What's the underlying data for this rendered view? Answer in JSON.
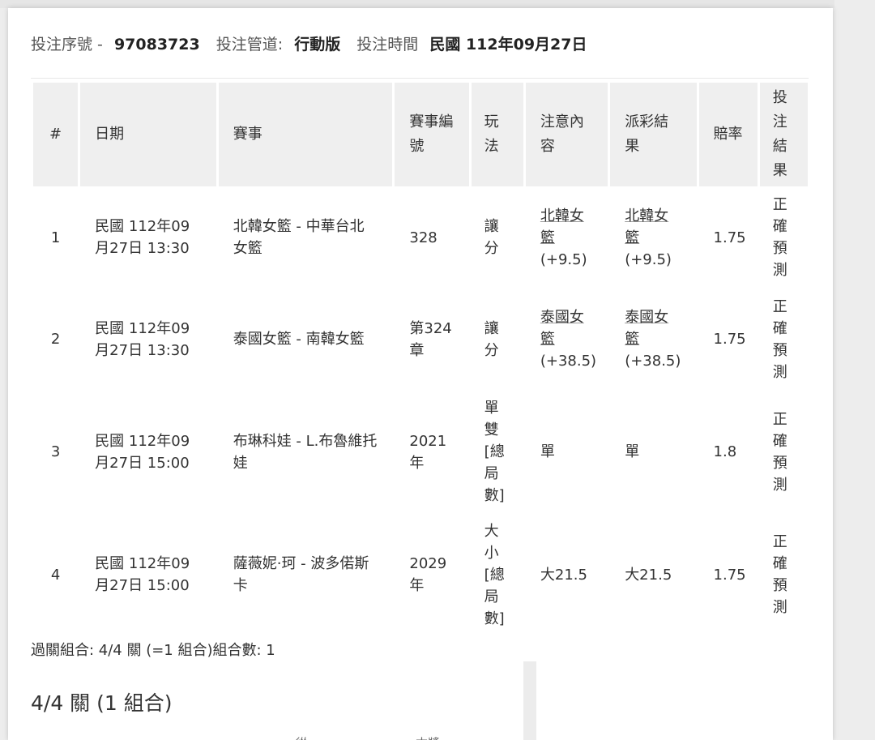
{
  "header": {
    "serial_label": "投注序號 -",
    "serial_value": "97083723",
    "channel_label": "投注管道:",
    "channel_value": "行動版",
    "time_label": "投注時間",
    "time_value": "民國 112年09月27日"
  },
  "table": {
    "headers": {
      "idx": "#",
      "date": "日期",
      "match": "賽事",
      "match_no": "賽事編號",
      "play": "玩法",
      "pick": "注意內容",
      "payout_result": "派彩結果",
      "odds": "賠率",
      "bet_result": "投注結果"
    },
    "rows": [
      {
        "idx": "1",
        "date": "民國 112年09月27日 13:30",
        "match": "北韓女籃 - 中華台北女籃",
        "match_no": "328",
        "play": "讓分",
        "pick_team": "北韓女籃",
        "pick_line": "(+9.5)",
        "result_team": "北韓女籃",
        "result_line": "(+9.5)",
        "odds": "1.75",
        "bet_result": "正確預測"
      },
      {
        "idx": "2",
        "date": "民國 112年09月27日 13:30",
        "match": "泰國女籃 - 南韓女籃",
        "match_no": "第324章",
        "play": "讓分",
        "pick_team": "泰國女籃",
        "pick_line": "(+38.5)",
        "result_team": "泰國女籃",
        "result_line": "(+38.5)",
        "odds": "1.75",
        "bet_result": "正確預測"
      },
      {
        "idx": "3",
        "date": "民國 112年09月27日 15:00",
        "match": "布琳科娃 - L.布魯維托娃",
        "match_no": "2021年",
        "play": "單雙[總局數]",
        "pick_team": "單",
        "pick_line": "",
        "result_team": "單",
        "result_line": "",
        "odds": "1.8",
        "bet_result": "正確預測"
      },
      {
        "idx": "4",
        "date": "民國 112年09月27日 15:00",
        "match": "薩薇妮·珂 - 波多偌斯卡",
        "match_no": "2029年",
        "play": "大小[總局數]",
        "pick_team": "大21.5",
        "pick_line": "",
        "result_team": "大21.5",
        "result_line": "",
        "odds": "1.75",
        "bet_result": "正確預測"
      }
    ]
  },
  "summary": "過關組合: 4/4 關 (=1 組合)組合數: 1",
  "combo_title": "4/4 關 (1 組合)",
  "bottom_partial_1": "從",
  "bottom_partial_2": "本獎"
}
